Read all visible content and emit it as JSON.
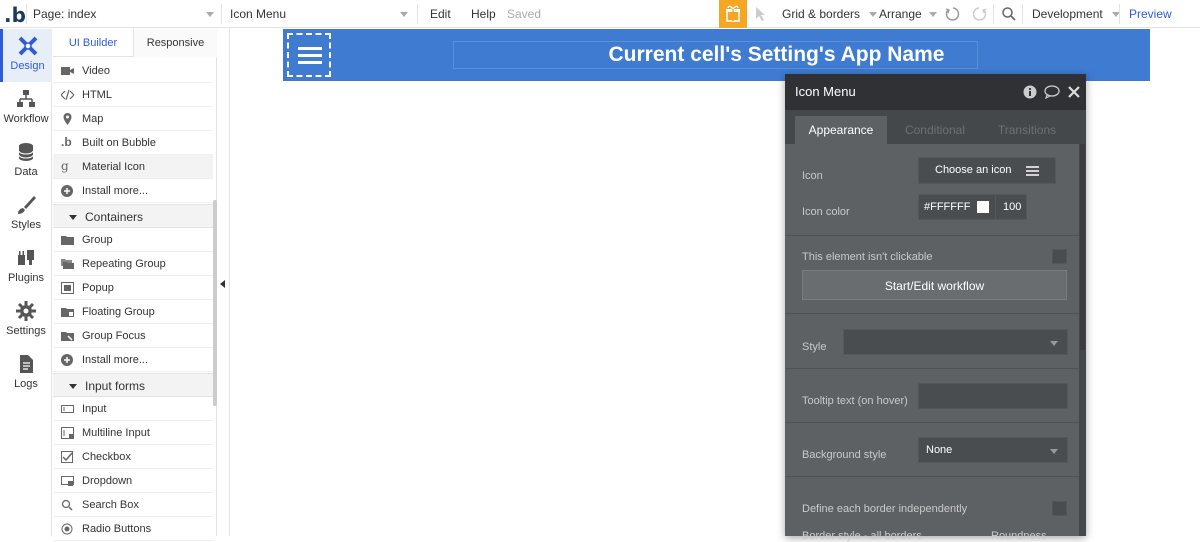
{
  "topbar": {
    "page_label": "Page: index",
    "element_select": "Icon Menu",
    "edit": "Edit",
    "help": "Help",
    "saved": "Saved",
    "grid": "Grid & borders",
    "arrange": "Arrange",
    "env": "Development",
    "preview": "Preview"
  },
  "rail": {
    "design": "Design",
    "workflow": "Workflow",
    "data": "Data",
    "styles": "Styles",
    "plugins": "Plugins",
    "settings": "Settings",
    "logs": "Logs"
  },
  "panel": {
    "tab_ui": "UI Builder",
    "tab_responsive": "Responsive",
    "visual_items": [
      "Video",
      "HTML",
      "Map",
      "Built on Bubble",
      "Material Icon",
      "Install more..."
    ],
    "containers_label": "Containers",
    "containers": [
      "Group",
      "Repeating Group",
      "Popup",
      "Floating Group",
      "Group Focus",
      "Install more..."
    ],
    "inputs_label": "Input forms",
    "inputs": [
      "Input",
      "Multiline Input",
      "Checkbox",
      "Dropdown",
      "Search Box",
      "Radio Buttons"
    ]
  },
  "canvas": {
    "header_title": "Current cell's Setting's App Name"
  },
  "property": {
    "title": "Icon Menu",
    "tab_appearance": "Appearance",
    "tab_conditional": "Conditional",
    "tab_transitions": "Transitions",
    "icon_label": "Icon",
    "icon_button": "Choose an icon",
    "icon_color_label": "Icon color",
    "icon_color_hex": "#FFFFFF",
    "icon_color_opacity": "100",
    "not_clickable": "This element isn't clickable",
    "workflow_button": "Start/Edit workflow",
    "style_label": "Style",
    "tooltip_label": "Tooltip text (on hover)",
    "bg_style_label": "Background style",
    "bg_style_value": "None",
    "border_indep": "Define each border independently",
    "border_style": "Border style - all borders",
    "roundness": "Roundness"
  },
  "colors": {
    "accent": "#2e5bd8",
    "header_blue": "#3f7bd1",
    "panel_dark": "#5e6164",
    "gift": "#f5a623"
  }
}
